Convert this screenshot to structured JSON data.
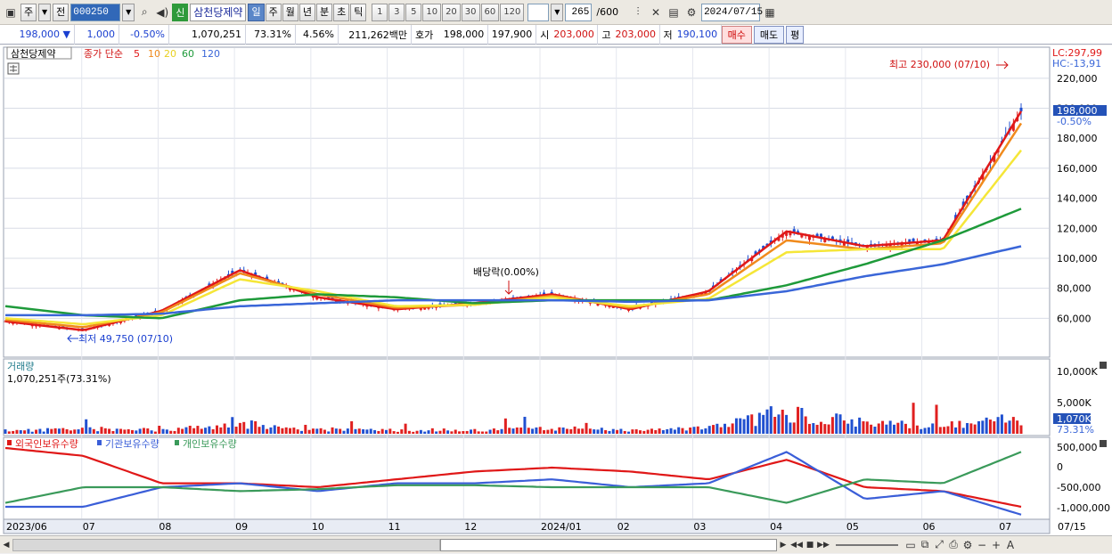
{
  "toolbar": {
    "period_label": "주",
    "prev_label": "전",
    "code": "000250",
    "new_badge": "신",
    "stock_name": "삼천당제약",
    "tabs": [
      "일",
      "주",
      "월",
      "년",
      "분",
      "초",
      "틱"
    ],
    "active_tab": "일",
    "intervals": [
      "1",
      "3",
      "5",
      "10",
      "20",
      "30",
      "60",
      "120"
    ],
    "count_label": "265",
    "count_max": "/600",
    "date": "2024/07/15"
  },
  "quote": {
    "price": "198,000",
    "change": "1,000",
    "change_pct": "-0.50%",
    "volume": "1,070,251",
    "vol_ratio": "73.31%",
    "turnover": "4.56%",
    "amount": "211,262백만",
    "ask_label": "호가",
    "ask": "198,000",
    "bid": "197,900",
    "open_label": "시",
    "open": "203,000",
    "high_label": "고",
    "high": "203,000",
    "low_label": "저",
    "low": "190,100",
    "buy_label": "매수",
    "sell_label": "매도",
    "extra_label": "평"
  },
  "price_panel": {
    "stock_tag": "삼천당제약",
    "ma_title": "종가 단순",
    "ma_periods": [
      "5",
      "10",
      "20",
      "60",
      "120"
    ],
    "lc": "LC:297,99",
    "hc": "HC:-13,91",
    "last_price": "198,000",
    "last_pct": "-0.50%",
    "high_annotation": "최고 230,000 (07/10)",
    "low_annotation": "최저 49,750 (07/10)",
    "dividend_annotation": "배당락(0.00%)",
    "y_ticks": [
      "220,000",
      "200,000",
      "180,000",
      "160,000",
      "140,000",
      "120,000",
      "100,000",
      "80,000",
      "60,000"
    ]
  },
  "volume_panel": {
    "title": "거래량",
    "value": "1,070,251주(73.31%)",
    "y_ticks": [
      "10,000K",
      "5,000K"
    ],
    "last_value": "1,070K",
    "last_pct": "73.31%"
  },
  "holdings_panel": {
    "series": [
      "외국인보유수량",
      "기관보유수량",
      "개인보유수량"
    ],
    "y_ticks": [
      "500,000",
      "0",
      "-500,000",
      "-1,000,000"
    ]
  },
  "x_axis": [
    "2023/06",
    "07",
    "08",
    "09",
    "10",
    "11",
    "12",
    "2024/01",
    "02",
    "03",
    "04",
    "05",
    "06",
    "07",
    "07/15"
  ],
  "colors": {
    "ma5": "#e01818",
    "ma10": "#f08a1c",
    "ma20": "#f5e638",
    "ma60": "#1e9a3a",
    "ma120": "#3a66d8",
    "up": "#e02020",
    "down": "#2050d0",
    "foreign": "#e01818",
    "institution": "#3a5ed8",
    "individual": "#3a9a5a"
  },
  "chart_data": {
    "type": "line",
    "title": "",
    "x": [
      "2023/06",
      "07",
      "08",
      "09",
      "10",
      "11",
      "12",
      "2024/01",
      "02",
      "03",
      "04",
      "05",
      "06",
      "07"
    ],
    "series": [
      {
        "name": "5",
        "values": [
          58000,
          52000,
          65000,
          92000,
          74000,
          66000,
          70000,
          76000,
          66000,
          78000,
          118000,
          108000,
          112000,
          198000
        ]
      },
      {
        "name": "10",
        "values": [
          59000,
          54000,
          64000,
          90000,
          76000,
          67000,
          69000,
          75000,
          67000,
          76000,
          112000,
          106000,
          110000,
          190000
        ]
      },
      {
        "name": "20",
        "values": [
          60000,
          56000,
          62000,
          86000,
          78000,
          68000,
          69000,
          74000,
          68000,
          73000,
          104000,
          106000,
          106000,
          172000
        ]
      },
      {
        "name": "60",
        "values": [
          68000,
          62000,
          60000,
          72000,
          76000,
          74000,
          70000,
          72000,
          72000,
          72000,
          82000,
          96000,
          112000,
          133000
        ]
      },
      {
        "name": "120",
        "values": [
          62000,
          62000,
          63000,
          68000,
          70000,
          72000,
          72000,
          72000,
          71000,
          72000,
          78000,
          88000,
          96000,
          108000
        ]
      }
    ],
    "ylim": [
      40000,
      230000
    ],
    "high_value": 230000,
    "low_value": 49750
  }
}
